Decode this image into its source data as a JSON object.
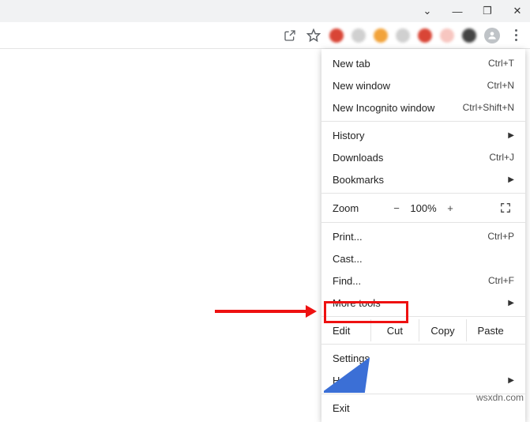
{
  "window_controls": {
    "dropdown": "⌄",
    "minimize": "—",
    "maximize": "❐",
    "close": "✕"
  },
  "menu": {
    "new_tab": {
      "label": "New tab",
      "shortcut": "Ctrl+T"
    },
    "new_window": {
      "label": "New window",
      "shortcut": "Ctrl+N"
    },
    "new_incognito": {
      "label": "New Incognito window",
      "shortcut": "Ctrl+Shift+N"
    },
    "history": {
      "label": "History"
    },
    "downloads": {
      "label": "Downloads",
      "shortcut": "Ctrl+J"
    },
    "bookmarks": {
      "label": "Bookmarks"
    },
    "zoom": {
      "label": "Zoom",
      "minus": "−",
      "value": "100%",
      "plus": "+"
    },
    "print": {
      "label": "Print...",
      "shortcut": "Ctrl+P"
    },
    "cast": {
      "label": "Cast..."
    },
    "find": {
      "label": "Find...",
      "shortcut": "Ctrl+F"
    },
    "more_tools": {
      "label": "More tools"
    },
    "edit": {
      "label": "Edit",
      "cut": "Cut",
      "copy": "Copy",
      "paste": "Paste"
    },
    "settings": {
      "label": "Settings"
    },
    "help": {
      "label": "Help"
    },
    "exit": {
      "label": "Exit"
    }
  },
  "watermark": "wsxdn.com"
}
